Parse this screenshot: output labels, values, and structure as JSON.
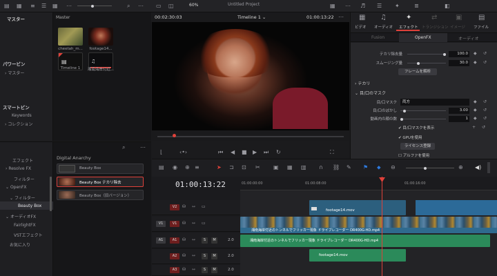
{
  "app": {
    "project_name": "Untitled Project"
  },
  "media_pool": {
    "sidebar_title": "マスター",
    "bin_title": "Master",
    "clips": [
      {
        "label": "cheetah_m..."
      },
      {
        "label": "footage14..."
      },
      {
        "label": "Timeline 1"
      },
      {
        "label": "湘南海岸付近..."
      }
    ],
    "power_bin_title": "パワービン",
    "power_bin_item": "マスター",
    "smart_bin_title": "スマートビン",
    "smart_bin_items": [
      "Keywords",
      "コレクション"
    ]
  },
  "viewer": {
    "source_timecode": "00:02:30:03",
    "zoom": "60%",
    "timeline_name": "Timeline 1",
    "record_timecode": "01:00:13:22"
  },
  "inspector": {
    "tabs": [
      "ビデオ",
      "オーディオ",
      "エフェクト",
      "トランジション",
      "イメージ",
      "ファイル"
    ],
    "subtabs": [
      "Fusion",
      "OpenFX",
      "オーディオ"
    ],
    "params": [
      {
        "label": "テカリ除去量",
        "value": "100.0"
      },
      {
        "label": "スムージング量",
        "value": "30.0"
      }
    ],
    "analyze_button": "フレームを解析",
    "section_tekari": "テカリ",
    "section_mask": "目/口のマスク",
    "mask_label": "目/口マスク",
    "mask_value": "両方",
    "blur_label": "目/口のぼかし",
    "blur_value": "3.00",
    "inner_label": "動画内の顔の数",
    "inner_value": "1",
    "check_show_mask": "目/口マスクを表示",
    "check_gpu": "GPUを使用",
    "license_button": "ライセンス登録",
    "check_alpha": "アルファを使用"
  },
  "effects_library": {
    "tree": [
      {
        "label": "エフェクト"
      },
      {
        "label": "Resolve FX"
      },
      {
        "label": "フィルター"
      },
      {
        "label": "OpenFX"
      },
      {
        "label": "フィルター"
      },
      {
        "label": "Beauty Box"
      },
      {
        "label": "オーディオFX"
      },
      {
        "label": "FairlightFX"
      },
      {
        "label": "VSTエフェクト"
      },
      {
        "label": "お気に入り"
      }
    ],
    "group_title": "Digital Anarchy",
    "items": [
      {
        "label": "Beauty Box"
      },
      {
        "label": "Beauty Box テカリ除去"
      },
      {
        "label": "Beauty Box（旧バージョン）"
      }
    ]
  },
  "timeline": {
    "timecode": "01:00:13:22",
    "ruler": [
      "01:00:00:00",
      "01:00:08:00",
      "01:00:16:00"
    ],
    "tracks": [
      {
        "id": "V2",
        "patch": "V2"
      },
      {
        "id": "V1",
        "patch": "V1"
      },
      {
        "id": "A1",
        "patch": "A1",
        "vol": "2.0"
      },
      {
        "id": "A2",
        "patch": "A2",
        "vol": "2.0"
      },
      {
        "id": "A3",
        "patch": "A3",
        "vol": "2.0"
      }
    ],
    "clips": {
      "v2_clip": "footage14.mov",
      "v1_clip": "湘南海岸付近のトンネルでフリッカー現象 ドライブレコーダー DR400G-HD.mp4",
      "a1_clip": "湘南海岸付近のトンネルでフリッカー現象 ドライブレコーダー DR400G-HD.mp4",
      "a2_clip": "footage14.mov"
    }
  },
  "colors": {
    "accent_red": "#e0413a",
    "v_track_blue": "#2f6a8e",
    "audio_green": "#2b8a5a"
  }
}
